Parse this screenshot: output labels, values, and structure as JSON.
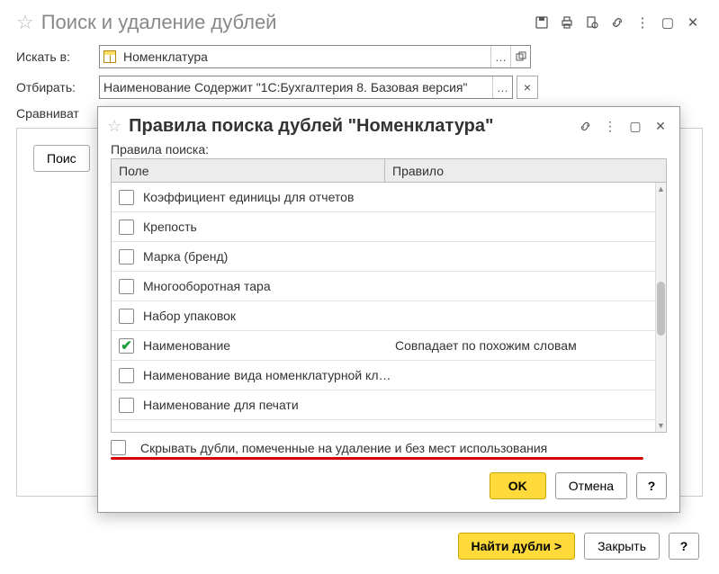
{
  "mainWindow": {
    "title": "Поиск и удаление дублей",
    "labels": {
      "searchIn": "Искать в:",
      "filter": "Отбирать:",
      "compare": "Сравниват"
    },
    "searchInValue": "Номенклатура",
    "filterValue": "Наименование Содержит \"1С:Бухгалтерия 8. Базовая версия\"",
    "searchButtonPartial": "Поис",
    "footer": {
      "findDuplicates": "Найти дубли >",
      "close": "Закрыть",
      "help": "?"
    }
  },
  "modal": {
    "title": "Правила поиска дублей \"Номенклатура\"",
    "rulesLabel": "Правила поиска:",
    "columns": {
      "field": "Поле",
      "rule": "Правило"
    },
    "rows": [
      {
        "checked": false,
        "field": "Коэффициент единицы для отчетов",
        "rule": ""
      },
      {
        "checked": false,
        "field": "Крепость",
        "rule": ""
      },
      {
        "checked": false,
        "field": "Марка (бренд)",
        "rule": ""
      },
      {
        "checked": false,
        "field": "Многооборотная тара",
        "rule": ""
      },
      {
        "checked": false,
        "field": "Набор упаковок",
        "rule": ""
      },
      {
        "checked": true,
        "field": "Наименование",
        "rule": "Совпадает по похожим словам"
      },
      {
        "checked": false,
        "field": "Наименование вида номенклатурной кла...",
        "rule": ""
      },
      {
        "checked": false,
        "field": "Наименование для печати",
        "rule": ""
      }
    ],
    "hideDuplicates": {
      "checked": false,
      "label": "Скрывать дубли, помеченные на удаление и без мест использования"
    },
    "buttons": {
      "ok": "OK",
      "cancel": "Отмена",
      "help": "?"
    }
  }
}
